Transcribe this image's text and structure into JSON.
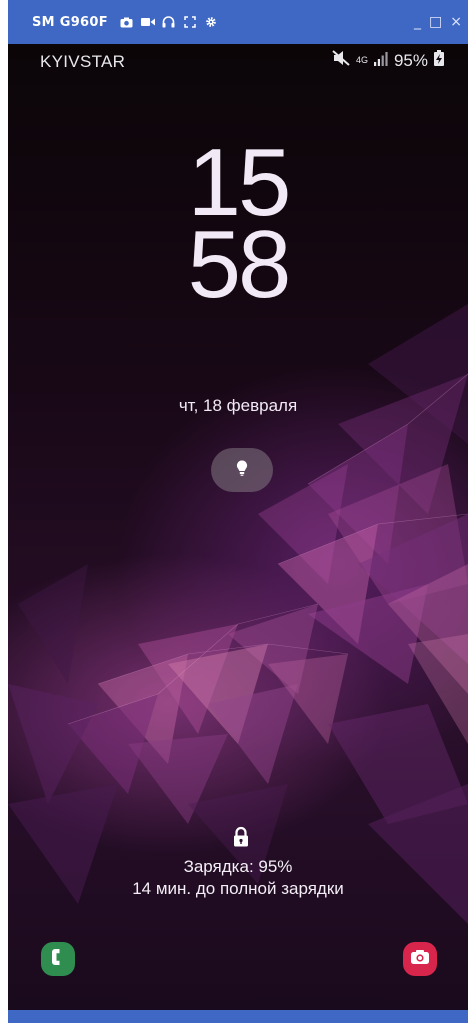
{
  "titlebar": {
    "device": "SM G960F",
    "tool_icons": [
      "camera-icon",
      "video-icon",
      "headset-icon",
      "fullscreen-icon",
      "settings-icon"
    ],
    "window_controls": [
      "_",
      "□",
      "×"
    ]
  },
  "statusbar": {
    "carrier": "KYIVSTAR",
    "network": "4G",
    "battery": "95%",
    "icons": [
      "mute-icon",
      "signal-icon",
      "battery-charging-icon"
    ]
  },
  "lockscreen": {
    "hours": "15",
    "minutes": "58",
    "date": "чт, 18 февраля",
    "flashlight_icon": "flashlight-icon",
    "lock_icon": "lock-icon",
    "charging_status": "Зарядка: 95%",
    "charging_time": "14 мин. до полной зарядки"
  },
  "shortcuts": {
    "left": "phone-icon",
    "right": "camera-icon"
  },
  "colors": {
    "titlebar": "#3f67c4",
    "phone_shortcut": "#2f8d4f",
    "camera_shortcut": "#d8254c",
    "text": "#f1e9f6"
  }
}
